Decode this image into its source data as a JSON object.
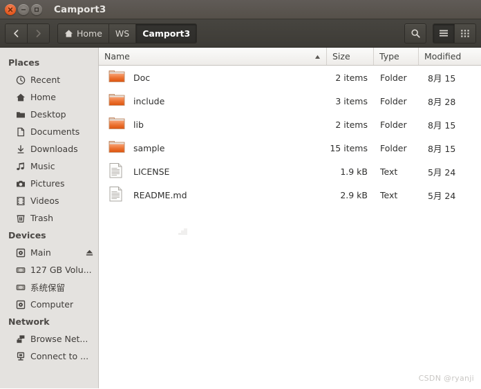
{
  "window": {
    "title": "Camport3",
    "controls": {
      "close": "close-button",
      "minimize": "minimize-button",
      "maximize": "maximize-button"
    }
  },
  "toolbar": {
    "back_label": "Back",
    "forward_label": "Forward",
    "search_label": "Search",
    "list_view_label": "List view",
    "grid_view_label": "Icon view",
    "breadcrumbs": [
      {
        "label": "Home",
        "icon": "home-icon",
        "active": false
      },
      {
        "label": "WS",
        "icon": "",
        "active": false
      },
      {
        "label": "Camport3",
        "icon": "",
        "active": true
      }
    ]
  },
  "sidebar": {
    "sections": [
      {
        "title": "Places",
        "items": [
          {
            "label": "Recent",
            "icon": "clock-icon"
          },
          {
            "label": "Home",
            "icon": "home-icon"
          },
          {
            "label": "Desktop",
            "icon": "desktop-folder-icon"
          },
          {
            "label": "Documents",
            "icon": "document-icon"
          },
          {
            "label": "Downloads",
            "icon": "download-icon"
          },
          {
            "label": "Music",
            "icon": "music-note-icon"
          },
          {
            "label": "Pictures",
            "icon": "camera-icon"
          },
          {
            "label": "Videos",
            "icon": "film-icon"
          },
          {
            "label": "Trash",
            "icon": "trash-icon"
          }
        ]
      },
      {
        "title": "Devices",
        "items": [
          {
            "label": "Main",
            "icon": "disc-icon",
            "eject": true
          },
          {
            "label": "127 GB Volu...",
            "icon": "harddisk-icon"
          },
          {
            "label": "系统保留",
            "icon": "harddisk-icon"
          },
          {
            "label": "Computer",
            "icon": "disc-icon"
          }
        ]
      },
      {
        "title": "Network",
        "items": [
          {
            "label": "Browse Net...",
            "icon": "network-icon"
          },
          {
            "label": "Connect to ...",
            "icon": "server-icon"
          }
        ]
      }
    ]
  },
  "file_list": {
    "columns": [
      "Name",
      "Size",
      "Type",
      "Modified"
    ],
    "sort_column": "Name",
    "sort_direction": "ascending",
    "rows": [
      {
        "name": "Doc",
        "size": "2 items",
        "type": "Folder",
        "modified": "8月 15",
        "icon": "folder-icon"
      },
      {
        "name": "include",
        "size": "3 items",
        "type": "Folder",
        "modified": "8月 28",
        "icon": "folder-icon"
      },
      {
        "name": "lib",
        "size": "2 items",
        "type": "Folder",
        "modified": "8月 15",
        "icon": "folder-icon"
      },
      {
        "name": "sample",
        "size": "15 items",
        "type": "Folder",
        "modified": "8月 15",
        "icon": "folder-icon"
      },
      {
        "name": "LICENSE",
        "size": "1.9 kB",
        "type": "Text",
        "modified": "5月 24",
        "icon": "text-file-icon"
      },
      {
        "name": "README.md",
        "size": "2.9 kB",
        "type": "Text",
        "modified": "5月 24",
        "icon": "text-file-icon"
      }
    ]
  },
  "watermark": {
    "text": "CSDN @ryanji"
  },
  "colors": {
    "titlebar": "#5a5551",
    "toolbar": "#413f3a",
    "sidebar": "#e4e2df",
    "pane": "#ffffff",
    "folder_accent": "#e3621d",
    "close_button": "#e2551b"
  }
}
